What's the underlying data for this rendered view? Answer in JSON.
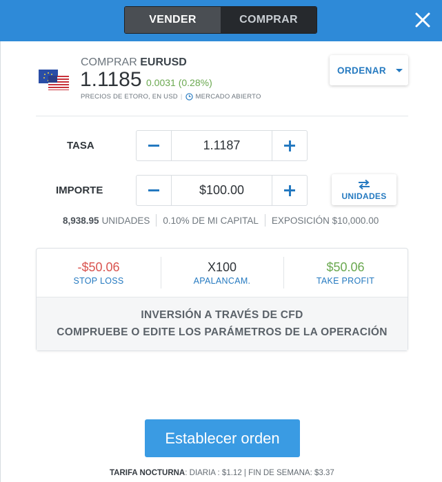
{
  "header": {
    "sell_label": "VENDER",
    "buy_label": "COMPRAR",
    "close_icon": "close-icon"
  },
  "instrument": {
    "action": "COMPRAR",
    "symbol": "EURUSD",
    "price": "1.1185",
    "change": "0.0031 (0.28%)",
    "price_note": "PRECIOS DE ETORO, EN USD",
    "market_status": "MERCADO ABIERTO",
    "flag_icon": "eu-us-flag-icon"
  },
  "order_type": {
    "label": "ORDENAR"
  },
  "rate": {
    "label": "TASA",
    "value": "1.1187"
  },
  "amount": {
    "label": "IMPORTE",
    "value": "$100.00",
    "units_button": "UNIDADES"
  },
  "summary": {
    "units_value": "8,938.95",
    "units_label": "UNIDADES",
    "capital": "0.10% DE MI CAPITAL",
    "exposure": "EXPOSICIÓN $10,000.00"
  },
  "params": {
    "stop_loss_value": "-$50.06",
    "stop_loss_label": "STOP LOSS",
    "leverage_value": "X100",
    "leverage_label": "APALANCAM.",
    "take_profit_value": "$50.06",
    "take_profit_label": "TAKE PROFIT",
    "notice_line1": "INVERSIÓN A TRAVÉS DE CFD",
    "notice_line2": "COMPRUEBE O EDITE LOS PARÁMETROS DE LA OPERACIÓN"
  },
  "submit": {
    "label": "Establecer orden"
  },
  "fees": {
    "title": "TARIFA NOCTURNA",
    "daily": ": DIARIA : $1.12",
    "separator": "|",
    "weekend": "FIN DE SEMANA: $3.37"
  },
  "colors": {
    "header_blue": "#2e8ad8",
    "accent_blue": "#2479c0",
    "loss_red": "#d9534f",
    "profit_green": "#6aa84f",
    "button_blue": "#3a9be3"
  }
}
